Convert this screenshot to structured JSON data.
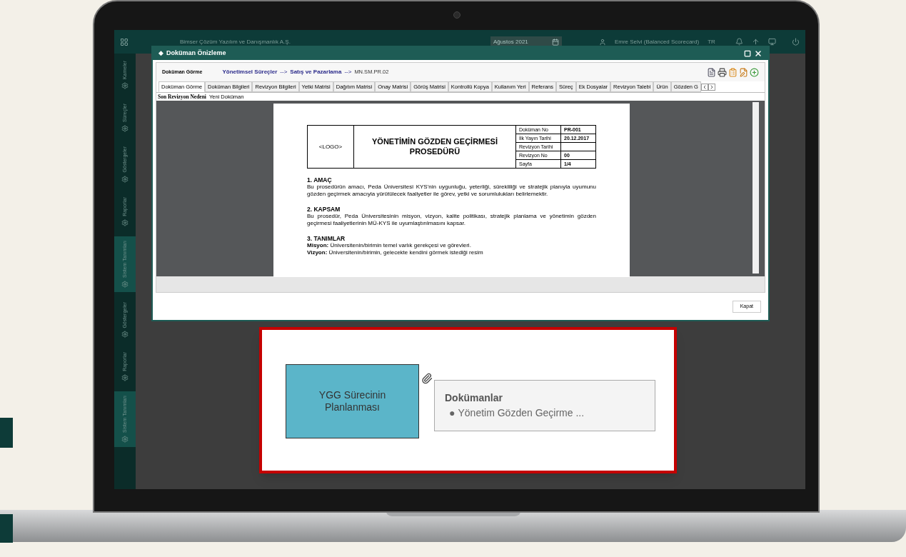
{
  "app_bar": {
    "company": "Bimser Çözüm Yazılım ve Danışmanlık A.Ş.",
    "date": "Ağustos 2021",
    "user": "Emre Selvi (Balanced Scorecard)",
    "language": "TR"
  },
  "sidebar": {
    "items": [
      {
        "label": "Kameler",
        "selected": false
      },
      {
        "label": "Süreçler",
        "selected": false
      },
      {
        "label": "Göstergeler",
        "selected": false
      },
      {
        "label": "Raporlar",
        "selected": false
      },
      {
        "label": "Sistem Tanımları",
        "selected": true
      },
      {
        "label": "Göstergeler",
        "selected": false
      },
      {
        "label": "Raporlar",
        "selected": false
      },
      {
        "label": "Sistem Tanımları",
        "selected": true
      }
    ]
  },
  "dialog": {
    "title_marker": "◆",
    "title": "Doküman Önizleme",
    "breadcrumb_separator": "-->",
    "section": "Doküman Görme",
    "breadcrumb": [
      {
        "label": "Yönetimsel Süreçler"
      },
      {
        "label": "Satış ve Pazarlama"
      },
      {
        "label": "MN.SM.PR.02",
        "kind": "code"
      }
    ],
    "tabs": [
      {
        "label": "Doküman Görme",
        "selected": true
      },
      {
        "label": "Doküman Bilgileri",
        "selected": false
      },
      {
        "label": "Revizyon Bilgileri",
        "selected": false
      },
      {
        "label": "Yetki Matrisi",
        "selected": false
      },
      {
        "label": "Dağıtım Matrisi",
        "selected": false
      },
      {
        "label": "Onay Matrisi",
        "selected": false
      },
      {
        "label": "Görüş Matrisi",
        "selected": false
      },
      {
        "label": "Kontrollü Kopya",
        "selected": false
      },
      {
        "label": "Kullanım Yeri",
        "selected": false
      },
      {
        "label": "Referans",
        "selected": false
      },
      {
        "label": "Süreç",
        "selected": false
      },
      {
        "label": "Ek Dosyalar",
        "selected": false
      },
      {
        "label": "Revizyon Talebi",
        "selected": false
      },
      {
        "label": "Ürün",
        "selected": false
      },
      {
        "label": "Gözden G",
        "selected": false
      }
    ],
    "revision_label": "Son Revizyon Nedeni",
    "revision_value": "Yeni Doküman",
    "document": {
      "logo": "<LOGO>",
      "title": "YÖNETİMİN GÖZDEN GEÇİRMESİ PROSEDÜRÜ",
      "info": [
        {
          "label": "Doküman No",
          "value": "PR-001"
        },
        {
          "label": "İlk Yayın Tarihi",
          "value": "20.12.2017"
        },
        {
          "label": "Revizyon Tarihi"
        },
        {
          "label": "Revizyon No",
          "value": "00"
        },
        {
          "label": "Sayfa",
          "value": "1/4"
        }
      ],
      "sections": [
        {
          "heading": "1. AMAÇ",
          "lines": [
            "Bu prosedürün amacı, Peda Üniversitesi KYS'nin uygunluğu, yeterliği, sürekliliği ve stratejik planıyla uyumunu gözden geçirmek amacıyla yürütülecek faaliyetler ile görev, yetki ve sorumlulukları belirlemektir."
          ]
        },
        {
          "heading": "2. KAPSAM",
          "lines": [
            "Bu prosedür, Peda Üniversitesinin misyon, vizyon, kalite politikası, stratejik planlama ve yönetimin gözden geçirmesi faaliyetlerinin MÜ-KYS ile uyumlaştırılmasını kapsar."
          ]
        },
        {
          "heading": "3. TANIMLAR",
          "lines": [
            "**Misyon:** Üniversitenin/birimin temel varlık gerekçesi ve görevleri.",
            "**Vizyon:** Üniversitenin/birimin, gelecekte kendini görmek istediği resim"
          ]
        }
      ]
    },
    "close_button": "Kapat"
  },
  "callout": {
    "bullet": "●",
    "process": "YGG Sürecinin Planlanması",
    "documents_title": "Dokümanlar",
    "documents": [
      "Yönetim Gözden Geçirme ..."
    ]
  }
}
